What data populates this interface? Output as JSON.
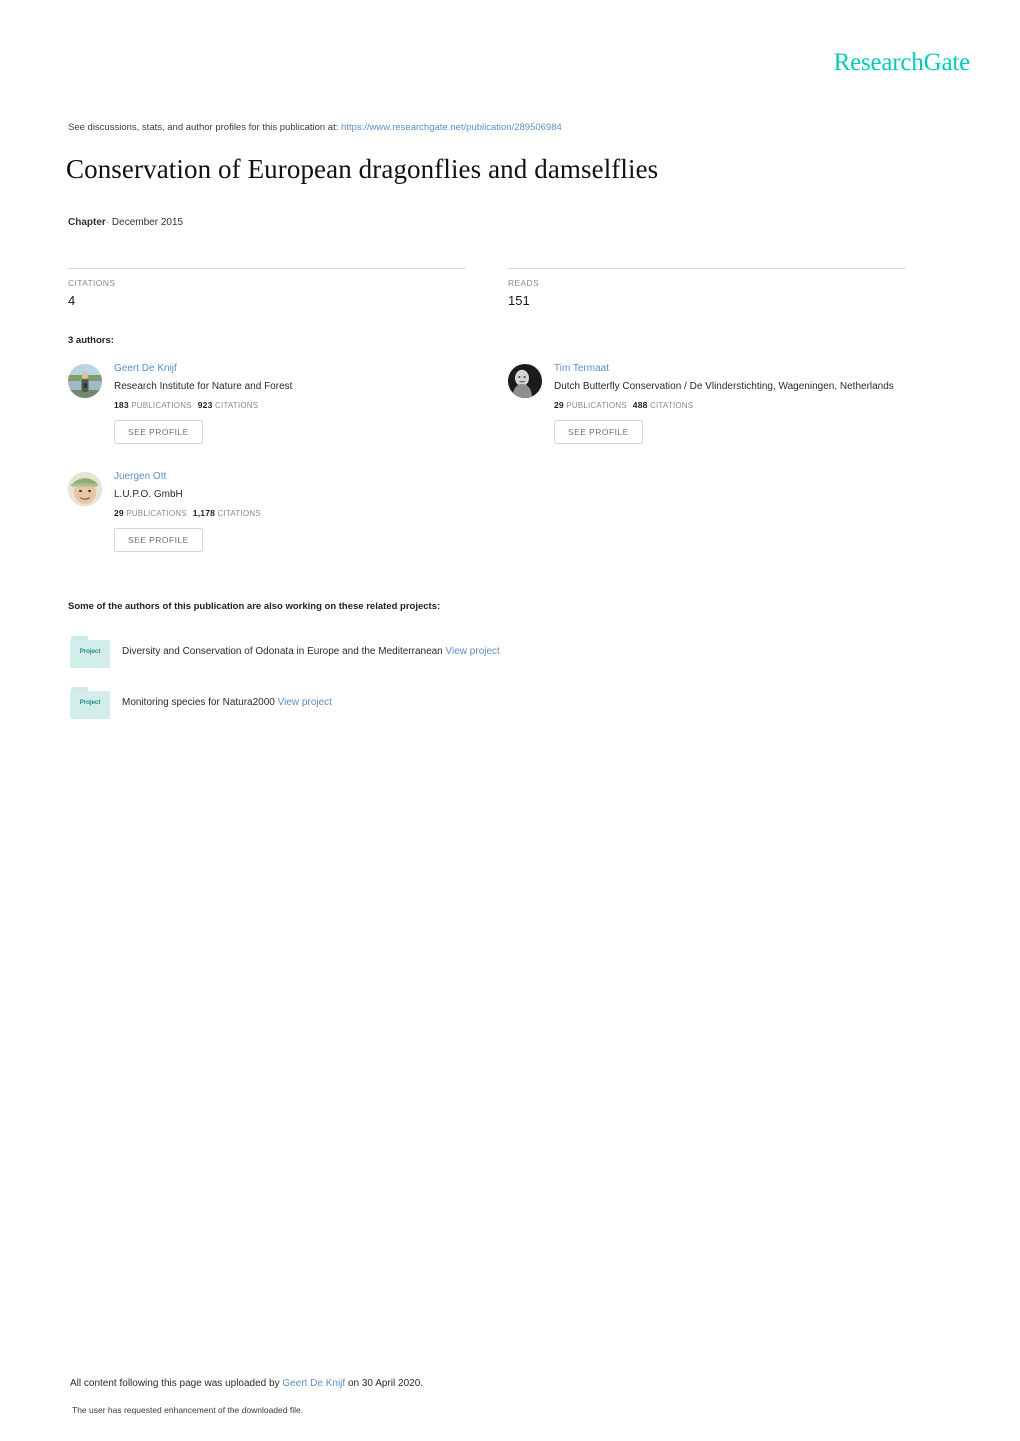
{
  "brand": {
    "logo_text": "ResearchGate",
    "logo_color": "#00ccbb",
    "link_color": "#5b8fc9"
  },
  "header": {
    "discussion_prefix": "See discussions, stats, and author profiles for this publication at:",
    "publication_url": "https://www.researchgate.net/publication/289506984"
  },
  "publication": {
    "title": "Conservation of European dragonflies and damselflies",
    "type": "Chapter",
    "separator": "·",
    "date": "December 2015"
  },
  "stats": {
    "citations": {
      "label": "CITATIONS",
      "value": "4"
    },
    "reads": {
      "label": "READS",
      "value": "151"
    }
  },
  "authors_section": {
    "heading": "3 authors:",
    "see_profile_label": "SEE PROFILE",
    "publications_label": "PUBLICATIONS",
    "citations_label": "CITATIONS",
    "authors": [
      {
        "name": "Geert De Knijf",
        "affiliation": "Research Institute for Nature and Forest",
        "publications": "183",
        "citations": "923",
        "avatar": "outdoor-portrait-photo"
      },
      {
        "name": "Tim Termaat",
        "affiliation": "Dutch Butterfly Conservation / De Vlinderstichting, Wageningen, Netherlands",
        "publications": "29",
        "citations": "488",
        "avatar": "monochrome-portrait-photo"
      },
      {
        "name": "Juergen Ott",
        "affiliation": "L.U.P.O. GmbH",
        "publications": "29",
        "citations": "1,178",
        "avatar": "man-with-green-cap-photo"
      }
    ]
  },
  "projects_section": {
    "heading": "Some of the authors of this publication are also working on these related projects:",
    "folder_icon_label": "Project",
    "view_project_label": "View project",
    "projects": [
      {
        "title": "Diversity and Conservation of Odonata in Europe and the Mediterranean"
      },
      {
        "title": "Monitoring species for Natura2000"
      }
    ]
  },
  "footer": {
    "upload_prefix": "All content following this page was uploaded by",
    "uploader": "Geert De Knijf",
    "upload_suffix": "on 30 April 2020.",
    "enhancement_note": "The user has requested enhancement of the downloaded file."
  }
}
